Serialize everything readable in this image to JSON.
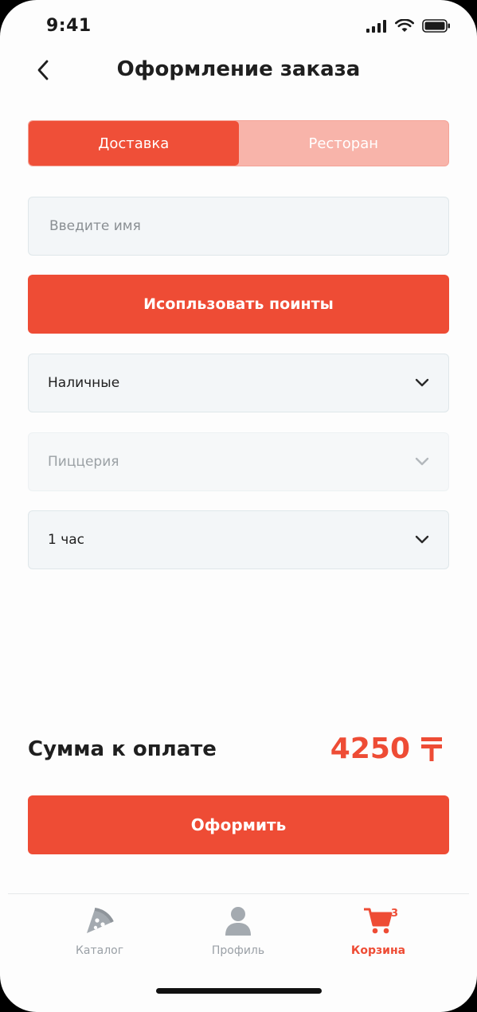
{
  "status_bar": {
    "time": "9:41"
  },
  "header": {
    "title": "Оформление заказа",
    "back_icon": "chevron-left-icon"
  },
  "delivery_tabs": [
    {
      "label": "Доставка",
      "active": true
    },
    {
      "label": "Ресторан",
      "active": false
    }
  ],
  "form": {
    "name_input": {
      "placeholder": "Введите имя",
      "value": ""
    },
    "points_button": "Исопльзовать поинты",
    "payment_select": {
      "value": "Наличные"
    },
    "pizzeria_select": {
      "placeholder": "Пиццерия",
      "disabled": true
    },
    "time_select": {
      "value": "1 час"
    }
  },
  "summary": {
    "label": "Сумма к оплате",
    "amount": "4250",
    "currency_icon": "tenge-icon"
  },
  "submit_button": "Оформить",
  "bottom_nav": {
    "items": [
      {
        "label": "Каталог",
        "icon": "pizza-icon",
        "active": false
      },
      {
        "label": "Профиль",
        "icon": "user-icon",
        "active": false
      },
      {
        "label": "Корзина",
        "icon": "cart-icon",
        "active": true,
        "badge": "3"
      }
    ]
  },
  "colors": {
    "accent": "#ee4c35",
    "accent_light": "#f8b4aa",
    "field_bg": "#f3f6f8",
    "inactive_nav": "#9aa0a6"
  }
}
